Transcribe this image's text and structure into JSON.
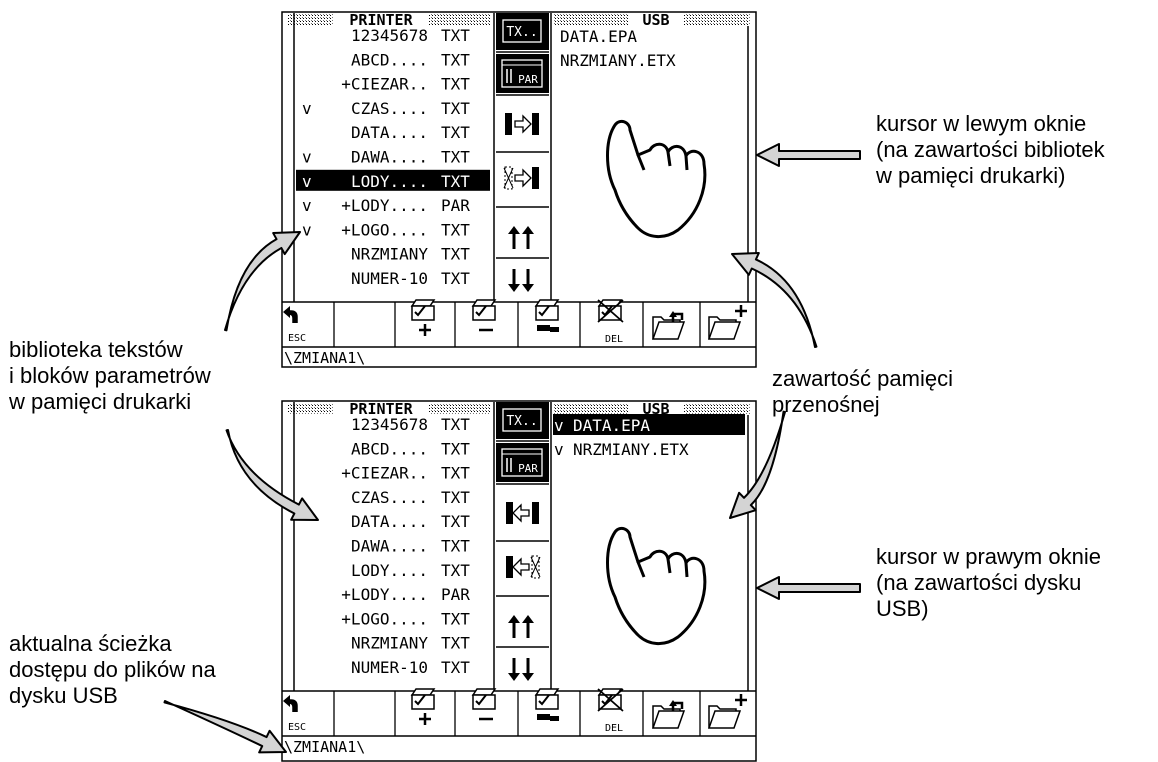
{
  "screens": [
    {
      "header_left": "PRINTER",
      "header_right": "USB",
      "left_rows": [
        {
          "mark": "",
          "name": "12345678",
          "ext": "TXT"
        },
        {
          "mark": "",
          "name": "ABCD....",
          "ext": "TXT"
        },
        {
          "mark": "",
          "name": "+CIEZAR..",
          "ext": "TXT"
        },
        {
          "mark": "v",
          "name": "CZAS....",
          "ext": "TXT"
        },
        {
          "mark": "",
          "name": "DATA....",
          "ext": "TXT"
        },
        {
          "mark": "v",
          "name": "DAWA....",
          "ext": "TXT"
        },
        {
          "mark": "v",
          "name": "LODY....",
          "ext": "TXT",
          "selected": true
        },
        {
          "mark": "v",
          "name": "+LODY....",
          "ext": "PAR"
        },
        {
          "mark": "v",
          "name": "+LOGO....",
          "ext": "TXT"
        },
        {
          "mark": "",
          "name": "NRZMIANY",
          "ext": "TXT"
        },
        {
          "mark": "",
          "name": "NUMER-10",
          "ext": "TXT"
        }
      ],
      "right_rows": [
        {
          "mark": "",
          "name": "DATA.EPA"
        },
        {
          "mark": "",
          "name": "NRZMIANY.ETX"
        }
      ],
      "tx_label": "TX..",
      "par_label": "PAR",
      "copy_direction": "right",
      "path": "\\ZMIANA1\\",
      "toolbar": {
        "esc": "ESC",
        "del": "DEL"
      }
    },
    {
      "header_left": "PRINTER",
      "header_right": "USB",
      "left_rows": [
        {
          "mark": "",
          "name": "12345678",
          "ext": "TXT"
        },
        {
          "mark": "",
          "name": "ABCD....",
          "ext": "TXT"
        },
        {
          "mark": "",
          "name": "+CIEZAR..",
          "ext": "TXT"
        },
        {
          "mark": "",
          "name": "CZAS....",
          "ext": "TXT"
        },
        {
          "mark": "",
          "name": "DATA....",
          "ext": "TXT"
        },
        {
          "mark": "",
          "name": "DAWA....",
          "ext": "TXT"
        },
        {
          "mark": "",
          "name": "LODY....",
          "ext": "TXT"
        },
        {
          "mark": "",
          "name": "+LODY....",
          "ext": "PAR"
        },
        {
          "mark": "",
          "name": "+LOGO....",
          "ext": "TXT"
        },
        {
          "mark": "",
          "name": "NRZMIANY",
          "ext": "TXT"
        },
        {
          "mark": "",
          "name": "NUMER-10",
          "ext": "TXT"
        }
      ],
      "right_rows": [
        {
          "mark": "v",
          "name": "DATA.EPA",
          "selected": true
        },
        {
          "mark": "v",
          "name": "NRZMIANY.ETX"
        }
      ],
      "tx_label": "TX..",
      "par_label": "PAR",
      "copy_direction": "left",
      "path": "\\ZMIANA1\\",
      "toolbar": {
        "esc": "ESC",
        "del": "DEL"
      }
    }
  ],
  "annotations": {
    "cursor_left": [
      "kursor w lewym oknie",
      "(na zawartości bibliotek",
      "w pamięci drukarki)"
    ],
    "library": [
      "biblioteka tekstów",
      "i bloków parametrów",
      "w pamięci drukarki"
    ],
    "usb_content": [
      "zawartość pamięci",
      "przenośnej"
    ],
    "cursor_right": [
      "kursor w prawym oknie",
      "(na zawartości dysku",
      "USB)"
    ],
    "path": [
      "aktualna ścieżka",
      "dostępu do plików na",
      "dysku USB"
    ]
  }
}
